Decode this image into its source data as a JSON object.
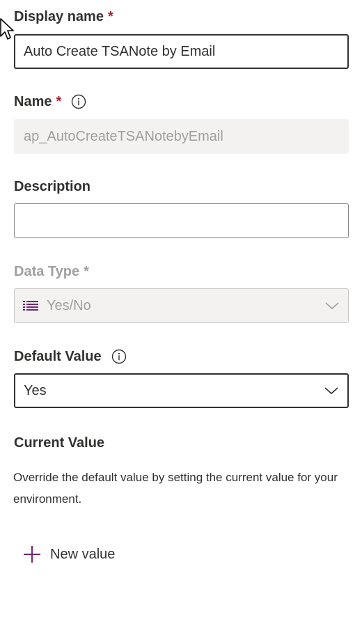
{
  "display_name": {
    "label": "Display name",
    "required": "*",
    "value": "Auto Create TSANote by Email"
  },
  "name": {
    "label": "Name",
    "required": "*",
    "value": "ap_AutoCreateTSANotebyEmail"
  },
  "description": {
    "label": "Description",
    "value": ""
  },
  "data_type": {
    "label": "Data Type",
    "required": "*",
    "value": "Yes/No"
  },
  "default_value": {
    "label": "Default Value",
    "value": "Yes"
  },
  "current_value": {
    "label": "Current Value",
    "help": "Override the default value by setting the current value for your environment.",
    "new_value_label": "New value"
  },
  "colors": {
    "required": "#a4262c",
    "accent": "#742774",
    "disabled_text": "#a19f9d"
  }
}
